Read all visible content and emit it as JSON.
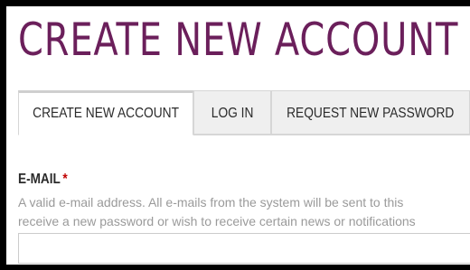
{
  "page": {
    "title": "CREATE NEW ACCOUNT"
  },
  "tabs": [
    {
      "label": "CREATE NEW ACCOUNT",
      "active": true
    },
    {
      "label": "LOG IN",
      "active": false
    },
    {
      "label": "REQUEST NEW PASSWORD",
      "active": false
    }
  ],
  "form": {
    "email": {
      "label": "E-MAIL",
      "required_marker": "*",
      "description_line1": "A valid e-mail address. All e-mails from the system will be sent to this",
      "description_line2": "receive a new password or wish to receive certain news or notifications",
      "value": ""
    }
  },
  "colors": {
    "title": "#6b1f5b",
    "required": "#c00000",
    "description": "#9a9a9a"
  }
}
